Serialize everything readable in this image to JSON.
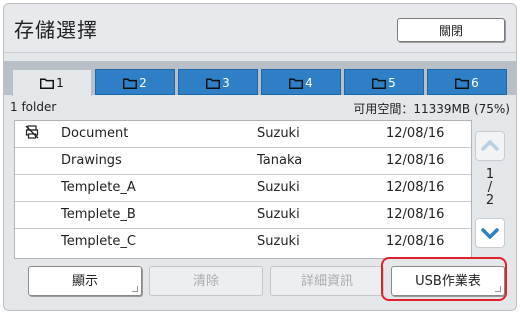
{
  "window": {
    "title": "存儲選擇",
    "close_label": "關閉"
  },
  "tabs": [
    {
      "label": "1",
      "active": true
    },
    {
      "label": "2",
      "active": false
    },
    {
      "label": "3",
      "active": false
    },
    {
      "label": "4",
      "active": false
    },
    {
      "label": "5",
      "active": false
    },
    {
      "label": "6",
      "active": false
    }
  ],
  "info": {
    "folder_count": "1 folder",
    "free_space": "可用空間：11339MB (75%)"
  },
  "files": [
    {
      "name": "Document",
      "owner": "Suzuki",
      "date": "12/08/16",
      "icon": "no-printer-icon"
    },
    {
      "name": "Drawings",
      "owner": "Tanaka",
      "date": "12/08/16",
      "icon": ""
    },
    {
      "name": "Templete_A",
      "owner": "Suzuki",
      "date": "12/08/16",
      "icon": ""
    },
    {
      "name": "Templete_B",
      "owner": "Suzuki",
      "date": "12/08/16",
      "icon": ""
    },
    {
      "name": "Templete_C",
      "owner": "Suzuki",
      "date": "12/08/16",
      "icon": ""
    }
  ],
  "pagination": {
    "current": "1",
    "separator": "/",
    "total": "2"
  },
  "buttons": {
    "show": "顯示",
    "clear": "清除",
    "details": "詳細資訊",
    "usb_jobs": "USB作業表"
  },
  "colors": {
    "tab_blue": "#2e7fc5",
    "highlight_red": "#e0202c",
    "scroll_arrow": "#2e7fc5"
  }
}
